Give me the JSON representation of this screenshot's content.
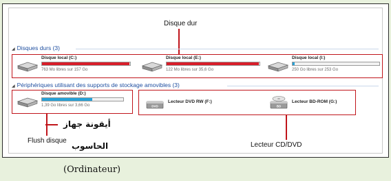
{
  "callouts": {
    "hard_disk": "Disque dur",
    "computer_icon_ar_1": "أيقونة جهاز",
    "computer_icon_ar_2": "الحاسوب",
    "flush": "Flush disque",
    "optical": "Lecteur CD/DVD"
  },
  "sections": {
    "hard_disks": "Disques durs (3)",
    "removable": "Périphériques utilisant des supports de stockage amovibles (3)"
  },
  "drives": [
    {
      "name": "Disque local (C:)",
      "free": "763 Mo libres sur 157 Go",
      "used_fraction": 0.99,
      "bar_color": "#d81e2a"
    },
    {
      "name": "Disque local (E:)",
      "free": "122 Mo libres sur 35,6 Go",
      "used_fraction": 0.99,
      "bar_color": "#d81e2a"
    },
    {
      "name": "Disque local (I:)",
      "free": "250 Go libres sur 253 Go",
      "used_fraction": 0.02,
      "bar_color": "#27a2d8"
    }
  ],
  "removable": {
    "name": "Disque amovible (D:)",
    "free": "1,39 Go libres sur 3,66 Go",
    "used_fraction": 0.62,
    "bar_color": "#27a2d8"
  },
  "optical_drives": [
    {
      "name": "Lecteur DVD RW (F:)",
      "icon": "dvd-drive-icon"
    },
    {
      "name": "Lecteur BD-ROM (G:)",
      "icon": "bd-drive-icon"
    }
  ],
  "caption": "(Ordinateur)",
  "colors": {
    "accent": "#c0141a",
    "section_title": "#1f4fa0",
    "background": "#e8f1dd"
  }
}
